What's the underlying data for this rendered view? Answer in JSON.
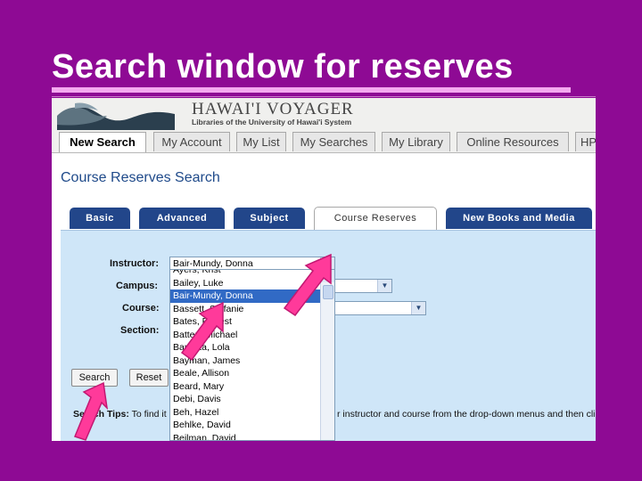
{
  "slide": {
    "title": "Search window for reserves"
  },
  "banner": {
    "title": "HAWAI'I VOYAGER",
    "subtitle": "Libraries of the University of Hawai'i System"
  },
  "top_tabs": [
    "New Search",
    "My Account",
    "My List",
    "My Searches",
    "My Library",
    "Online Resources",
    "HP"
  ],
  "page_heading": "Course Reserves Search",
  "search_tabs": [
    "Basic",
    "Advanced",
    "Subject",
    "Course Reserves",
    "New Books and Media"
  ],
  "form": {
    "instructor_label": "Instructor:",
    "instructor_value": "Bair-Mundy, Donna",
    "campus_label": "Campus:",
    "course_label": "Course:",
    "section_label": "Section:",
    "search_button": "Search",
    "reset_button": "Reset"
  },
  "instructor_options": [
    "Ayers, Krist",
    "Bailey, Luke",
    "Bair-Mundy, Donna",
    "Bassett, Stefanie",
    "Bates, Forrest",
    "Batten, Michael",
    "Bautista, Lola",
    "Bayman, James",
    "Beale, Allison",
    "Beard, Mary",
    "Debi, Davis",
    "Beh, Hazel",
    "Behlke, David",
    "Beilman, David"
  ],
  "selected_option_index": 2,
  "tips": {
    "label": "Search Tips:",
    "text": "To find it",
    "text_right": "r instructor and course from the drop-down menus and then click S"
  },
  "colors": {
    "slide_background": "#8e0a94",
    "tab_blue": "#22468a",
    "panel_blue": "#cfe6f8",
    "selection_blue": "#316ac5",
    "arrow_pink": "#ff3a9a"
  }
}
